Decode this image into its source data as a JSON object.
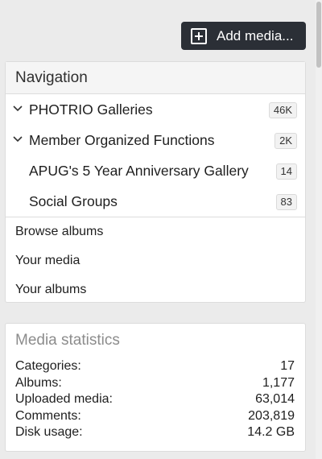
{
  "add_media": {
    "label": "Add media..."
  },
  "navigation": {
    "title": "Navigation",
    "items": [
      {
        "label": "PHOTRIO Galleries",
        "count": "46K",
        "expandable": true
      },
      {
        "label": "Member Organized Functions",
        "count": "2K",
        "expandable": true
      },
      {
        "label": "APUG's 5 Year Anniversary Gallery",
        "count": "14",
        "expandable": false
      },
      {
        "label": "Social Groups",
        "count": "83",
        "expandable": false
      }
    ],
    "links": [
      {
        "label": "Browse albums"
      },
      {
        "label": "Your media"
      },
      {
        "label": "Your albums"
      }
    ]
  },
  "media_statistics": {
    "title": "Media statistics",
    "rows": [
      {
        "label": "Categories:",
        "value": "17"
      },
      {
        "label": "Albums:",
        "value": "1,177"
      },
      {
        "label": "Uploaded media:",
        "value": "63,014"
      },
      {
        "label": "Comments:",
        "value": "203,819"
      },
      {
        "label": "Disk usage:",
        "value": "14.2 GB"
      }
    ]
  },
  "colors": {
    "button_bg": "#2b2f36",
    "page_bg": "#ebebeb",
    "muted_title": "#8c8c8c"
  },
  "icons": {
    "add": "plus-square-icon",
    "expand": "chevron-down-icon"
  }
}
